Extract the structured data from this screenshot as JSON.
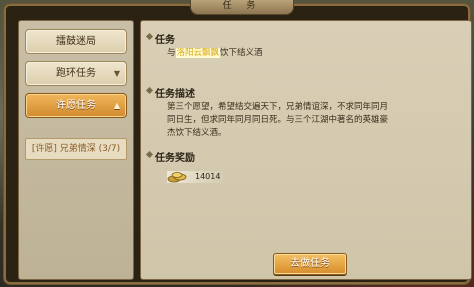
{
  "window": {
    "title": "任 务"
  },
  "tabs": [
    {
      "label": "擂鼓迷局"
    },
    {
      "label": "跑环任务"
    },
    {
      "label": "许愿任务"
    }
  ],
  "sub_items": [
    {
      "label": "[许愿] 兄弟情深 (3/7)"
    }
  ],
  "task": {
    "heading": "任务",
    "prefix": "与",
    "npc": "洛阳云飘飘",
    "suffix": "饮下结义酒"
  },
  "desc": {
    "heading": "任务描述",
    "lines": [
      "第三个愿望，希望结交遍天下，兄弟情谊深，不求同年同月",
      "同日生，但求同年同月同日死。与三个江湖中著名的英雄豪",
      "杰饮下结义酒。"
    ]
  },
  "reward": {
    "heading": "任务奖励",
    "icon": "coin-icon",
    "value": "14014"
  },
  "action": {
    "label": "去做任务"
  }
}
